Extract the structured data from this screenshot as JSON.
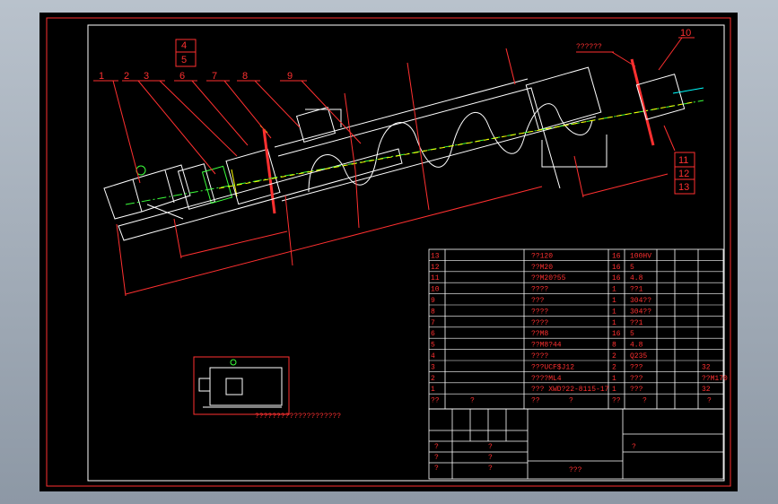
{
  "colors": {
    "background_outer": "#a3adb8",
    "canvas": "#000000",
    "frame": "#ffffff",
    "red": "#ff3030",
    "green": "#3cff3c",
    "yellow": "#ffff00",
    "cyan": "#00ffff"
  },
  "callouts": {
    "top_row": [
      "1",
      "2",
      "3",
      "6",
      "7",
      "8",
      "9"
    ],
    "stack_left": [
      "4",
      "5",
      "6"
    ],
    "right_top": "10",
    "right_top_note": "??????",
    "stack_right": [
      "11",
      "12",
      "13"
    ]
  },
  "bom": {
    "rows": [
      {
        "no": "13",
        "name": "??120",
        "qty": "16",
        "material": "100HV"
      },
      {
        "no": "12",
        "name": "??M20",
        "qty": "16",
        "material": "5"
      },
      {
        "no": "11",
        "name": "??M20?55",
        "qty": "16",
        "material": "4.8"
      },
      {
        "no": "10",
        "name": "????",
        "qty": "1",
        "material": "??1"
      },
      {
        "no": "9",
        "name": "???",
        "qty": "1",
        "material": "304??"
      },
      {
        "no": "8",
        "name": "????",
        "qty": "1",
        "material": "304??"
      },
      {
        "no": "7",
        "name": "????",
        "qty": "1",
        "material": "??1"
      },
      {
        "no": "6",
        "name": "??M8",
        "qty": "16",
        "material": "5"
      },
      {
        "no": "5",
        "name": "??M8?44",
        "qty": "8",
        "material": "4.8"
      },
      {
        "no": "4",
        "name": "????",
        "qty": "2",
        "material": "Q235"
      },
      {
        "no": "3",
        "name": "???UCF$J12",
        "qty": "2",
        "material": "???",
        "note": "32"
      },
      {
        "no": "2",
        "name": "????ML4",
        "qty": "1",
        "material": "???",
        "note": "??M170"
      },
      {
        "no": "1",
        "name": "???  XWD?22-8115-17",
        "qty": "1",
        "material": "???",
        "note": "32"
      }
    ],
    "header": [
      "??",
      "?",
      "??",
      "?",
      "??",
      "?",
      "?"
    ]
  },
  "title_block": {
    "title_cell": "???",
    "marks": [
      "?",
      "?",
      "?",
      "?",
      "?",
      "?",
      "?"
    ]
  },
  "motor_view_note": "????????????????????"
}
